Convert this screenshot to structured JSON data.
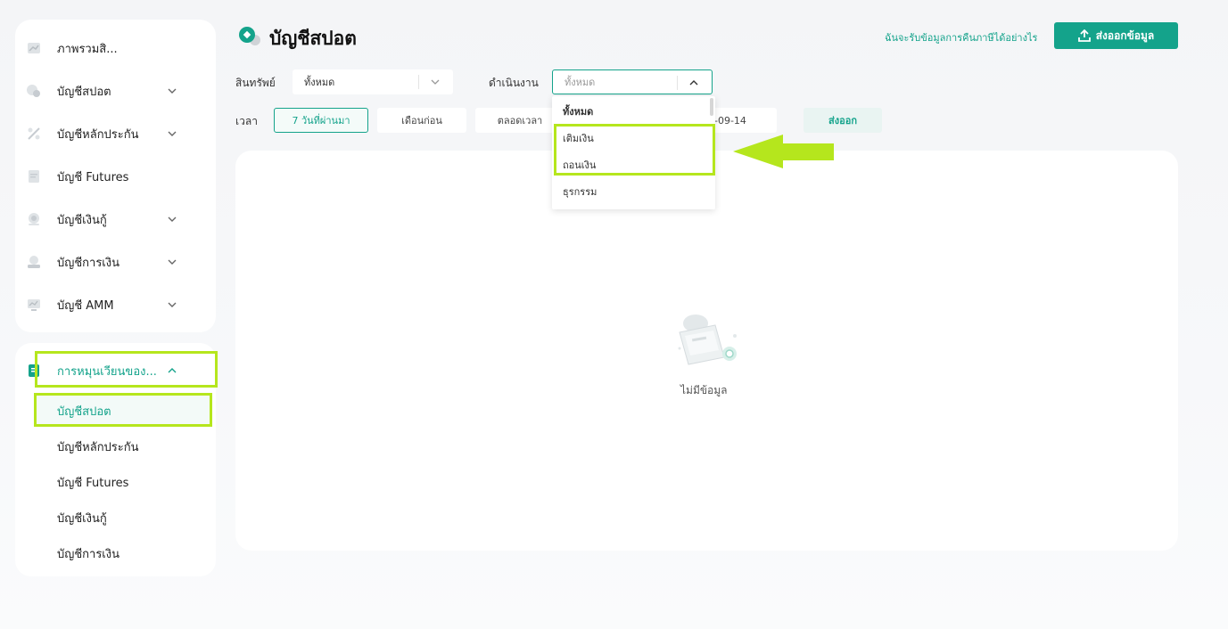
{
  "sidebar": {
    "items": [
      {
        "label": "ภาพรวมสิ..."
      },
      {
        "label": "บัญชีสปอต"
      },
      {
        "label": "บัญชีหลักประกัน"
      },
      {
        "label": "บัญชี Futures"
      },
      {
        "label": "บัญชีเงินกู้"
      },
      {
        "label": "บัญชีการเงิน"
      },
      {
        "label": "บัญชี AMM"
      }
    ],
    "history": {
      "label": "การหมุนเวียนของ...",
      "sub_items": [
        {
          "label": "บัญชีสปอต"
        },
        {
          "label": "บัญชีหลักประกัน"
        },
        {
          "label": "บัญชี Futures"
        },
        {
          "label": "บัญชีเงินกู้"
        },
        {
          "label": "บัญชีการเงิน"
        }
      ]
    }
  },
  "header": {
    "title": "บัญชีสปอต",
    "hint_link": "ฉันจะรับข้อมูลการคืนภาษีได้อย่างไร",
    "export_label": "ส่งออกข้อมูล"
  },
  "filters": {
    "asset_label": "สินทรัพย์",
    "asset_value": "ทั้งหมด",
    "operation_label": "ดำเนินงาน",
    "operation_value": "ทั้งหมด",
    "time_label": "เวลา",
    "time_options": [
      "7 วันที่ผ่านมา",
      "เดือนก่อน",
      "ตลอดเวลา"
    ],
    "date_end": "-09-14",
    "export_label": "ส่งออก"
  },
  "dropdown": {
    "options": [
      "ทั้งหมด",
      "เติมเงิน",
      "ถอนเงิน",
      "ธุรกรรม"
    ]
  },
  "empty": {
    "label": "ไม่มีข้อมูล"
  },
  "colors": {
    "accent": "#14a38b",
    "highlight": "#b5e61d"
  }
}
